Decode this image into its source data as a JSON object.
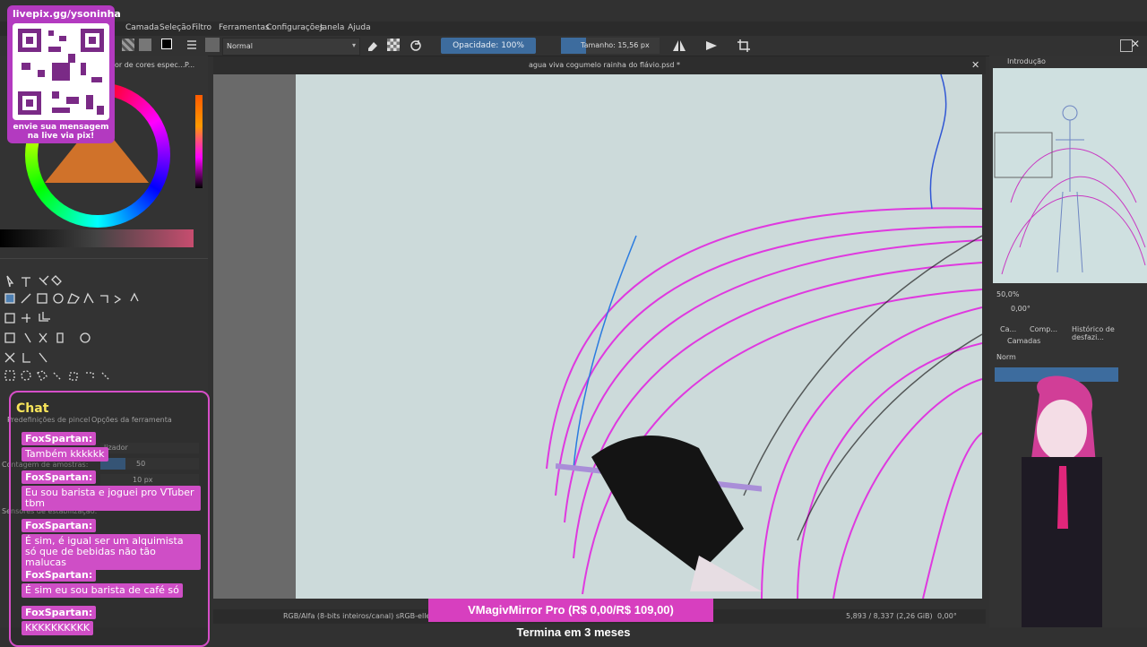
{
  "menu": [
    "Camada",
    "Seleção",
    "Filtro",
    "Ferramentas",
    "Configurações",
    "Janela",
    "Ajuda"
  ],
  "toolbar": {
    "blend_mode": "Normal",
    "opacity_label": "Opacidade: 100%",
    "size_label": "Tamanho: 15,56 px"
  },
  "document": {
    "tab_title": "agua viva cogumelo rainha do flávio.psd *"
  },
  "left_panel": {
    "color_selector_label": "or de cores espec...",
    "color_tab_short": "P...",
    "brush_presets_tab": "Predefinições de pincel",
    "tool_options_tab": "Opções da ferramenta",
    "smoothing_option": "lizador",
    "sample_count_label": "Contagem de amostras:",
    "sample_count_value": "50",
    "stabilizer_sensors": "Sensores de estabilização:",
    "distance_value": "10 px"
  },
  "right_panel": {
    "overview_title": "Introdução",
    "zoom_value": "50,0%",
    "rotation_value": "0,00°",
    "tabs": [
      "Ca...",
      "Comp...",
      "Histórico de desfazi..."
    ],
    "layers_title": "Camadas",
    "blend_short": "Norm"
  },
  "status": {
    "color_space": "RGB/Alfa (8-bits inteiros/canal)  sRGB-elle-V2",
    "memory": "5,893 / 8,337 (2,26 GiB)",
    "rotation": "0,00°"
  },
  "stream_overlay": {
    "pix_url": "livepix.gg/ysoninha",
    "pix_caption": "envie sua mensagem na live via pix!",
    "chat_title": "Chat",
    "chat_messages": [
      {
        "user": "FoxSpartan:",
        "text": "Também kkkkkk"
      },
      {
        "user": "FoxSpartan:",
        "text": "Eu sou barista e joguei pro VTuber tbm"
      },
      {
        "user": "FoxSpartan:",
        "text": "É sim, é igual ser um alquimista só que de bebidas não tão malucas"
      },
      {
        "user": "FoxSpartan:",
        "text": "É sim eu sou barista de café só"
      },
      {
        "user": "FoxSpartan:",
        "text": "KKKKKKKKKK"
      }
    ],
    "ad_title": "VMagivMirror Pro (R$ 0,00/R$ 109,00)",
    "ad_subtitle": "Termina em 3 meses"
  },
  "colors": {
    "accent": "#3d6c9e",
    "overlay_pink": "#d73fbf",
    "canvas_bg": "#ccdada"
  }
}
